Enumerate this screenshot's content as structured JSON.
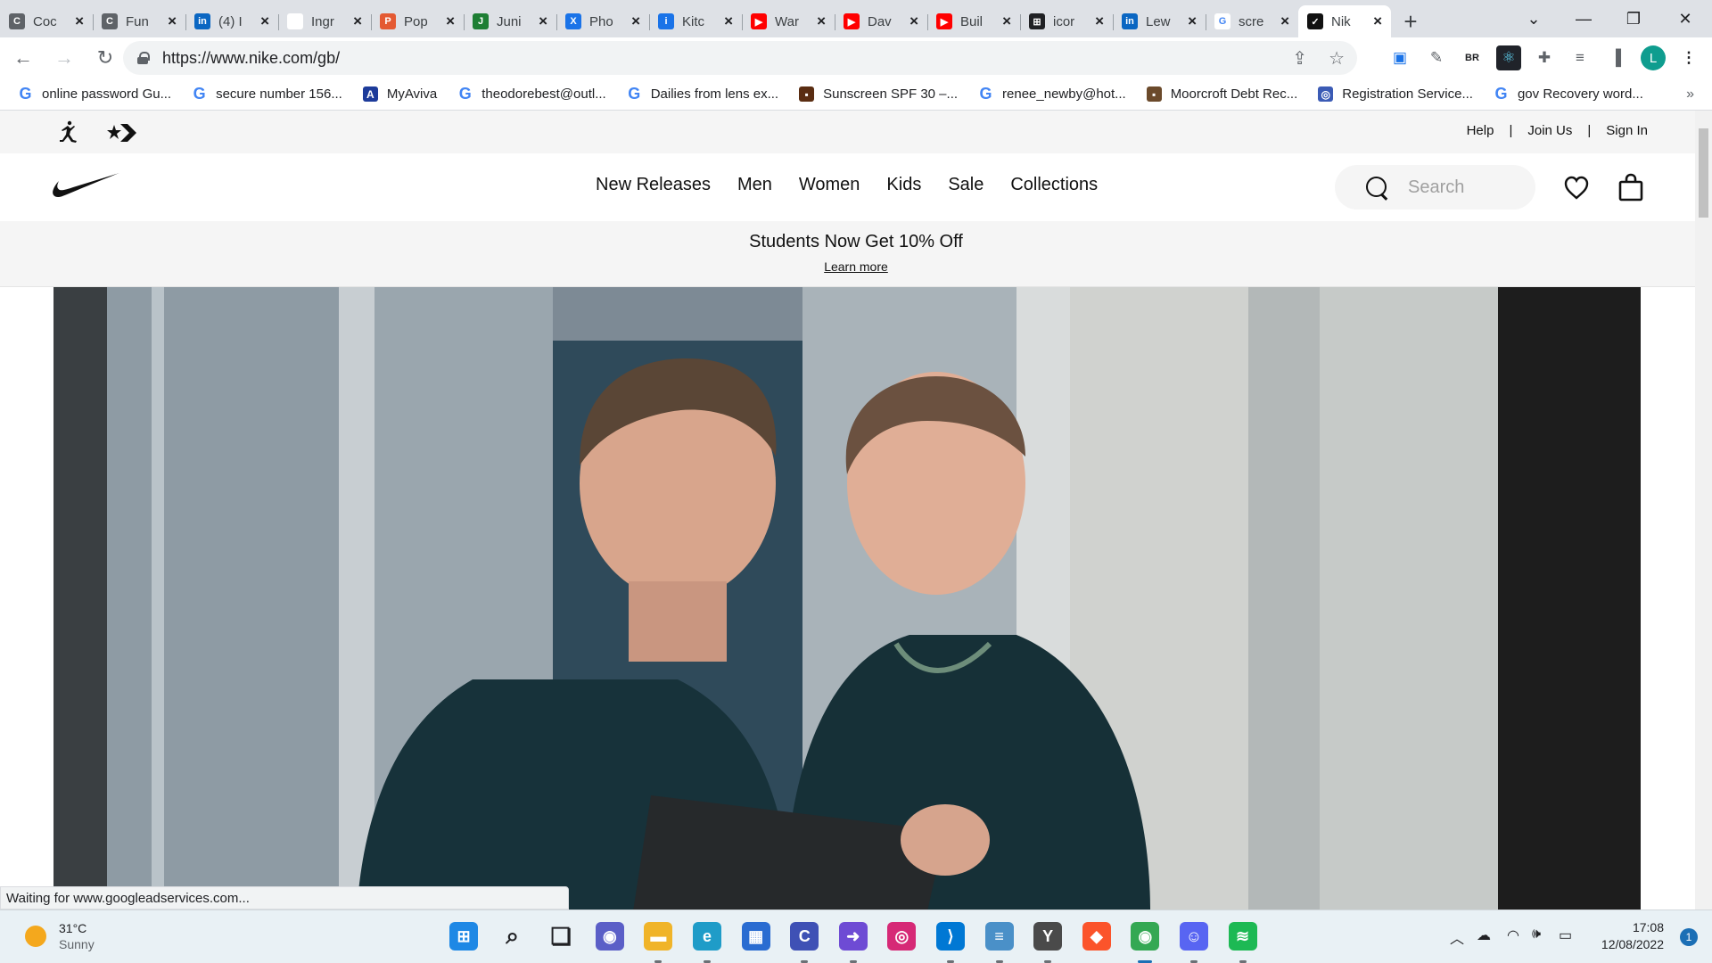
{
  "browser": {
    "tabs": [
      {
        "title": "Coc",
        "icon": "document-icon",
        "color": "#5f6368",
        "letter": "C"
      },
      {
        "title": "Fun",
        "icon": "document-icon",
        "color": "#5f6368",
        "letter": "C"
      },
      {
        "title": "(4) I",
        "icon": "linkedin-icon",
        "color": "#0a66c2",
        "letter": "in"
      },
      {
        "title": "Ingr",
        "icon": "blank-icon",
        "color": "#ffffff",
        "letter": ""
      },
      {
        "title": "Pop",
        "icon": "pop-icon",
        "color": "#e45a33",
        "letter": "P"
      },
      {
        "title": "Juni",
        "icon": "j-icon",
        "color": "#1e7e34",
        "letter": "J"
      },
      {
        "title": "Pho",
        "icon": "photo-icon",
        "color": "#1a73e8",
        "letter": "X"
      },
      {
        "title": "Kitc",
        "icon": "info-icon",
        "color": "#1a73e8",
        "letter": "i"
      },
      {
        "title": "War",
        "icon": "youtube-icon",
        "color": "#ff0000",
        "letter": "▶"
      },
      {
        "title": "Dav",
        "icon": "youtube-icon",
        "color": "#ff0000",
        "letter": "▶"
      },
      {
        "title": "Buil",
        "icon": "youtube-icon",
        "color": "#ff0000",
        "letter": "▶"
      },
      {
        "title": "icor",
        "icon": "icon-site-icon",
        "color": "#202124",
        "letter": "⊞"
      },
      {
        "title": "Lew",
        "icon": "linkedin-icon",
        "color": "#0a66c2",
        "letter": "in"
      },
      {
        "title": "scre",
        "icon": "google-icon",
        "color": "#ffffff",
        "letter": "G"
      },
      {
        "title": "Nik",
        "icon": "nike-icon",
        "color": "#111111",
        "letter": "✓",
        "active": true
      }
    ],
    "new_tab": "+",
    "window_controls": {
      "tab_search": "⌄",
      "minimize": "—",
      "maximize": "❐",
      "close": "✕"
    },
    "url": "https://www.nike.com/gb/",
    "extensions": {
      "br_label": "BR"
    },
    "profile_initial": "L"
  },
  "bookmarks": [
    {
      "label": "online password Gu...",
      "icon": "google-icon"
    },
    {
      "label": "secure number 156...",
      "icon": "google-icon"
    },
    {
      "label": "MyAviva",
      "icon": "aviva-icon"
    },
    {
      "label": "theodorebest@outl...",
      "icon": "google-icon"
    },
    {
      "label": "Dailies from lens ex...",
      "icon": "google-icon"
    },
    {
      "label": "Sunscreen SPF 30 –...",
      "icon": "sunscreen-icon"
    },
    {
      "label": "renee_newby@hot...",
      "icon": "google-icon"
    },
    {
      "label": "Moorcroft Debt Rec...",
      "icon": "building-icon"
    },
    {
      "label": "Registration Service...",
      "icon": "registration-icon"
    },
    {
      "label": "gov Recovery word...",
      "icon": "google-icon"
    }
  ],
  "bookmarks_overflow": "»",
  "nike": {
    "utility_links": [
      "Help",
      "Join Us",
      "Sign In"
    ],
    "utility_sep": "|",
    "nav": [
      "New Releases",
      "Men",
      "Women",
      "Kids",
      "Sale",
      "Collections"
    ],
    "search_placeholder": "Search",
    "promo_title": "Students Now Get 10% Off",
    "promo_link": "Learn more"
  },
  "status_bar": "Waiting for www.googleadservices.com...",
  "taskbar": {
    "weather_temp": "31°C",
    "weather_desc": "Sunny",
    "apps": [
      {
        "name": "windows-start-icon",
        "color": "#1e88e5"
      },
      {
        "name": "search-icon",
        "color": "#202124"
      },
      {
        "name": "task-view-icon",
        "color": "#202124"
      },
      {
        "name": "teams-chat-icon",
        "color": "#5b5fc7"
      },
      {
        "name": "file-explorer-icon",
        "color": "#f0b429"
      },
      {
        "name": "edge-icon",
        "color": "#1f9cc8"
      },
      {
        "name": "store-icon",
        "color": "#2a6cd1"
      },
      {
        "name": "app-c-icon",
        "color": "#3f51b5"
      },
      {
        "name": "app-arrow-icon",
        "color": "#6e4bd4"
      },
      {
        "name": "instagram-icon",
        "color": "#d62976"
      },
      {
        "name": "vscode-icon",
        "color": "#0078d4"
      },
      {
        "name": "notepad-icon",
        "color": "#4a90c8"
      },
      {
        "name": "app-y-icon",
        "color": "#4a4a4a"
      },
      {
        "name": "brave-icon",
        "color": "#fb542b"
      },
      {
        "name": "chrome-icon",
        "color": "#34a853"
      },
      {
        "name": "discord-icon",
        "color": "#5865f2"
      },
      {
        "name": "spotify-icon",
        "color": "#1db954"
      }
    ],
    "time": "17:08",
    "date": "12/08/2022",
    "notification_count": "1"
  }
}
